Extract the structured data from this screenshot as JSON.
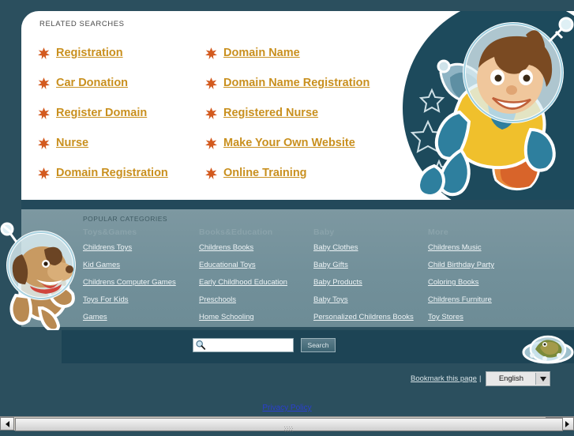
{
  "related": {
    "heading": "RELATED SEARCHES",
    "left_links": [
      "Registration",
      "Car Donation",
      "Register Domain",
      "Nurse",
      "Domain Registration"
    ],
    "right_links": [
      "Domain Name",
      "Domain Name Registration",
      "Registered Nurse",
      "Make Your Own Website",
      "Online Training"
    ]
  },
  "categories": {
    "heading": "POPULAR CATEGORIES",
    "columns": [
      {
        "header": "Toys&Games",
        "links": [
          "Childrens Toys",
          "Kid Games",
          "Childrens Computer Games",
          "Toys For Kids",
          "Games"
        ]
      },
      {
        "header": "Books&Education",
        "links": [
          "Childrens Books",
          "Educational Toys",
          "Early Childhood Education",
          "Preschools",
          "Home Schooling"
        ]
      },
      {
        "header": "Baby",
        "links": [
          "Baby Clothes",
          "Baby Gifts",
          "Baby Products",
          "Baby Toys",
          "Personalized Childrens Books"
        ]
      },
      {
        "header": "More",
        "links": [
          "Childrens Music",
          "Child Birthday Party",
          "Coloring Books",
          "Childrens Furniture",
          "Toy Stores"
        ]
      }
    ]
  },
  "search": {
    "value": "",
    "placeholder": "",
    "button_label": "Search",
    "icon": "magnifier-icon"
  },
  "footer": {
    "bookmark_label": "Bookmark this page",
    "separator": "|",
    "language_value": "English",
    "language_arrow": "▼",
    "privacy_label": "Privacy Policy"
  },
  "scrollbar": {
    "left_arrow": "◄",
    "right_arrow": "►"
  },
  "art": {
    "boy": "astronaut-boy-illustration",
    "dog": "astronaut-dog-illustration",
    "ufo": "alien-ufo-illustration",
    "star": "star-bullet-icon"
  },
  "colors": {
    "background": "#2b4f5e",
    "panel": "#ffffff",
    "link_gold": "#c9901f",
    "star_orange": "#d35a1f",
    "categories_panel": "#72909a",
    "footer_bar": "#1d4455",
    "privacy_blue": "#2b3fd0"
  }
}
